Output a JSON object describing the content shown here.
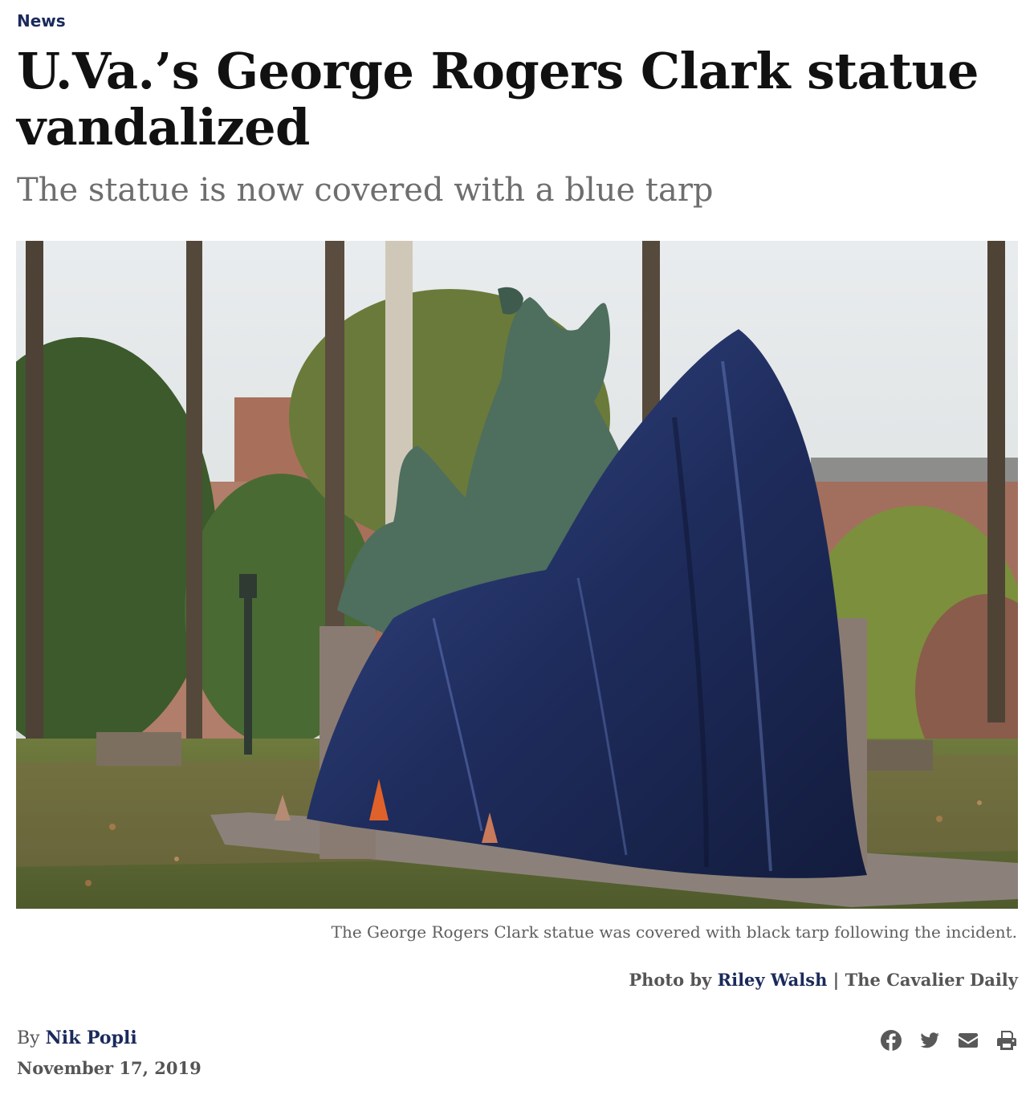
{
  "section": "News",
  "headline": "U.Va.’s George Rogers Clark statue vandalized",
  "subhead": "The statue is now covered with a blue tarp",
  "photo": {
    "alt": "The George Rogers Clark statue was covered with black tarp following the incident.",
    "caption": "The George Rogers Clark statue was covered with black tarp following the incident.",
    "credit_prefix": "Photo by",
    "photographer": "Riley Walsh",
    "separator": "|",
    "outlet": "The Cavalier Daily"
  },
  "byline": {
    "prefix": "By",
    "author": "Nik Popli",
    "date": "November 17, 2019"
  },
  "share": {
    "icons": [
      "facebook-icon",
      "twitter-icon",
      "email-icon",
      "print-icon"
    ],
    "color": "#595959"
  },
  "colors": {
    "accent": "#1b2a5c",
    "subhead": "#6e6e6e",
    "tarp": "#1f2d5e"
  }
}
